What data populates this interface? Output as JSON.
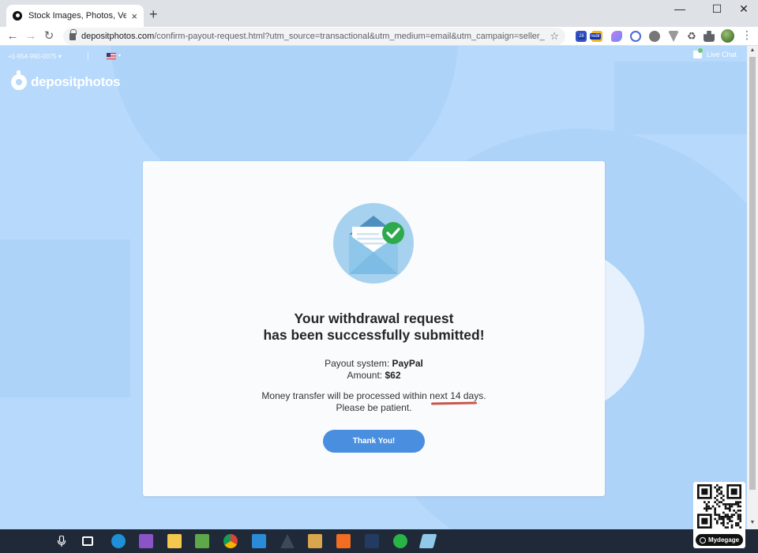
{
  "browser": {
    "tab_title": "Stock Images, Photos, Vectors, Illustrations",
    "tab_close": "×",
    "new_tab": "+",
    "url_domain": "depositphotos.com",
    "url_path": "/confirm-payout-request.html?utm_source=transactional&utm_medium=email&utm_campaign=seller_confir...",
    "minimize": "—",
    "maximize": "☐",
    "close": "✕",
    "back": "←",
    "forward": "→",
    "reload": "↻",
    "star": "☆",
    "menu": "⋮",
    "ext_badges": [
      "28",
      "redir"
    ]
  },
  "topbar": {
    "phone": "+1-954-990-0075 ▾",
    "live_chat": "Live Chat"
  },
  "brand": {
    "logo_text": "depositphotos"
  },
  "card": {
    "headline_line1": "Your withdrawal request",
    "headline_line2": "has been successfully submitted!",
    "payout_label": "Payout system:",
    "payout_value": "PayPal",
    "amount_label": "Amount:",
    "amount_value": "$62",
    "transfer_text": "Money transfer will be processed within next 14 days.",
    "patience_text": "Please be patient.",
    "button_label": "Thank You!"
  },
  "qr": {
    "brand": "Mydegage"
  },
  "colors": {
    "page_bg": "#b7d9fb",
    "button": "#4a8fdf",
    "check_green": "#2eaa4e",
    "taskbar": "#1f2938"
  }
}
